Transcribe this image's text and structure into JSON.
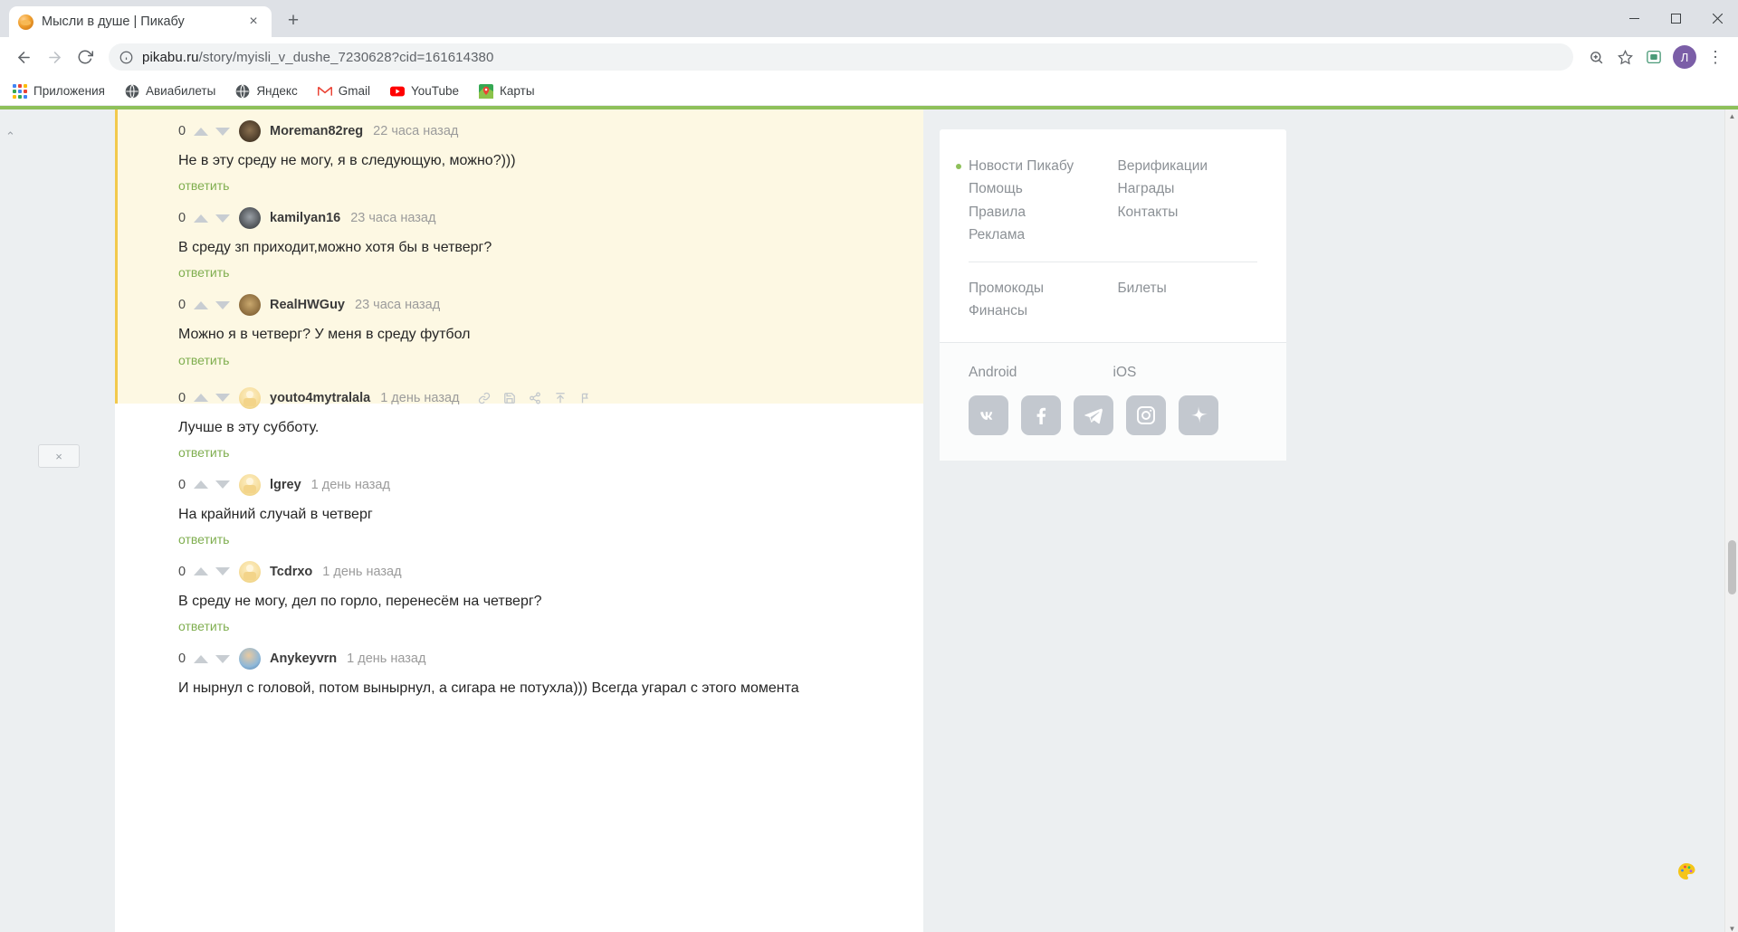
{
  "browser": {
    "tab": {
      "title": "Мысли в душе | Пикабу",
      "favicon": "pikabu-favicon",
      "close": "×"
    },
    "new_tab": "+",
    "window_controls": {
      "minimize": "—",
      "maximize": "▢",
      "close": "✕"
    },
    "nav": {
      "back": "←",
      "forward": "→",
      "reload": "⟳"
    },
    "omnibox": {
      "info_icon": "info-icon",
      "host": "pikabu.ru",
      "path": "/story/myisli_v_dushe_7230628?cid=161614380",
      "full_url": "pikabu.ru/story/myisli_v_dushe_7230628?cid=161614380"
    },
    "toolbar_icons": [
      "zoom-icon",
      "bookmark-star-icon",
      "extension-icon"
    ],
    "profile_initial": "Л",
    "menu": "⋮",
    "bookmarks": [
      {
        "label": "Приложения",
        "icon": "apps-grid-icon"
      },
      {
        "label": "Авиабилеты",
        "icon": "globe-icon"
      },
      {
        "label": "Яндекс",
        "icon": "globe-icon"
      },
      {
        "label": "Gmail",
        "icon": "gmail-icon"
      },
      {
        "label": "YouTube",
        "icon": "youtube-icon"
      },
      {
        "label": "Карты",
        "icon": "maps-icon"
      }
    ]
  },
  "page": {
    "rail": {
      "scroll_up": "⌃",
      "close_box": "×"
    },
    "reply_label": "ответить",
    "comments": [
      {
        "score": "0",
        "avatar": "av-cat1",
        "username": "Moreman82reg",
        "time": "22 часа назад",
        "text": "Не в эту среду не могу, я в следующую, можно?)))",
        "highlighted": true,
        "actions": []
      },
      {
        "score": "0",
        "avatar": "av-cat2",
        "username": "kamilyan16",
        "time": "23 часа назад",
        "text": "В среду зп приходит,можно хотя бы в четверг?",
        "highlighted": true,
        "actions": []
      },
      {
        "score": "0",
        "avatar": "av-cat3",
        "username": "RealHWGuy",
        "time": "23 часа назад",
        "text": "Можно я в четверг? У меня в среду футбол",
        "highlighted": true,
        "actions": []
      },
      {
        "score": "0",
        "avatar": "av-default",
        "username": "youto4mytralala",
        "time": "1 день назад",
        "text": "Лучше в эту субботу.",
        "highlighted": false,
        "actions": [
          "link-icon",
          "save-icon",
          "share-icon",
          "pin-icon",
          "flag-icon"
        ]
      },
      {
        "score": "0",
        "avatar": "av-default",
        "username": "lgrey",
        "time": "1 день назад",
        "text": "На крайний случай в четверг",
        "highlighted": false,
        "actions": []
      },
      {
        "score": "0",
        "avatar": "av-default",
        "username": "Tcdrxo",
        "time": "1 день назад",
        "text": "В среду не могу, дел по горло, перенесём на четверг?",
        "highlighted": false,
        "actions": []
      },
      {
        "score": "0",
        "avatar": "av-face",
        "username": "Anykeyvrn",
        "time": "1 день назад",
        "text": "И нырнул с головой, потом вынырнул, а сигара не потухла))) Всегда угарал с этого момента",
        "highlighted": false,
        "actions": []
      }
    ]
  },
  "sidebar": {
    "links": [
      {
        "label": "Новости Пикабу",
        "dot": true
      },
      {
        "label": "Верификации",
        "dot": false
      },
      {
        "label": "Помощь",
        "dot": false
      },
      {
        "label": "Награды",
        "dot": false
      },
      {
        "label": "Правила",
        "dot": false
      },
      {
        "label": "Контакты",
        "dot": false
      },
      {
        "label": "Реклама",
        "dot": false
      },
      {
        "label": "",
        "dot": false
      }
    ],
    "links2": [
      {
        "label": "Промокоды"
      },
      {
        "label": "Билеты"
      },
      {
        "label": "Финансы"
      },
      {
        "label": ""
      }
    ],
    "apps": [
      {
        "label": "Android"
      },
      {
        "label": "iOS"
      }
    ],
    "socials": [
      {
        "name": "vk-icon",
        "glyph": "VK"
      },
      {
        "name": "facebook-icon",
        "glyph": "f"
      },
      {
        "name": "telegram-icon",
        "glyph": "➤"
      },
      {
        "name": "instagram-icon",
        "glyph": "◻"
      },
      {
        "name": "zen-icon",
        "glyph": "✦"
      }
    ]
  },
  "scrollbar": {
    "up": "▲",
    "down": "▼"
  },
  "colors": {
    "accent_green": "#8ec05a",
    "highlight_yellow": "#fdf8e3",
    "thread_bar": "#f2c94c",
    "reply_green": "#7fae4f"
  }
}
